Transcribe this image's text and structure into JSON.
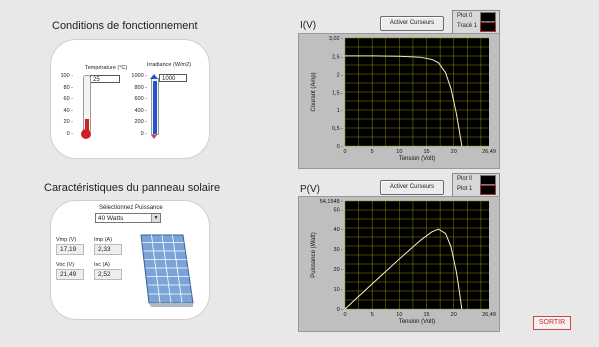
{
  "conditions": {
    "title": "Conditions de fonctionnement",
    "temperature": {
      "label": "Température (°C)",
      "value": "25",
      "ticks": [
        "100",
        "80",
        "60",
        "40",
        "20",
        "0"
      ],
      "fill_fraction": 0.25
    },
    "irradiance": {
      "label": "Irradiance (W/m2)",
      "value": "1000",
      "ticks": [
        "1000",
        "800",
        "600",
        "400",
        "200",
        "0"
      ],
      "fill_fraction": 1.0
    }
  },
  "panel": {
    "title": "Caractéristiques du panneau solaire",
    "select_label": "Sélectionnez Puissance",
    "select_value": "40 Watts",
    "vmp_label": "Vmp (V)",
    "vmp_value": "17,19",
    "imp_label": "Imp (A)",
    "imp_value": "2,33",
    "voc_label": "Voc (V)",
    "voc_value": "21,49",
    "isc_label": "Isc (A)",
    "isc_value": "2,52"
  },
  "iv_graph": {
    "title": "I(V)",
    "cursor_button": "Activer Curseurs",
    "legend": [
      "Plot 0",
      "Tracé 1"
    ]
  },
  "pv_graph": {
    "title": "P(V)",
    "cursor_button": "Activer Curseurs",
    "legend": [
      "Plot 0",
      "Plot 1"
    ]
  },
  "exit_button": "SORTIR",
  "colors": {
    "plot_background": "#000000",
    "grid": "#8a8a00",
    "curve": "#f5f0c8",
    "thermometer": "#cc2222",
    "irradiance_bar": "#2255cc",
    "exit_text": "#dd2222"
  },
  "chart_data": [
    {
      "type": "line",
      "title": "I(V)",
      "xlabel": "Tension (Volt)",
      "ylabel": "Courant (Amp)",
      "xlim": [
        0,
        26.49
      ],
      "ylim": [
        0,
        3.02
      ],
      "x_ticks": [
        "0",
        "5",
        "10",
        "15",
        "20",
        "26,49"
      ],
      "y_ticks": [
        "0",
        "0,5",
        "1",
        "1,5",
        "2",
        "2,5",
        "3,02"
      ],
      "grid": true,
      "series": [
        {
          "x": [
            0,
            5,
            10,
            14,
            16,
            17.19,
            18.5,
            19.5,
            20.5,
            21.0,
            21.49
          ],
          "values": [
            2.52,
            2.52,
            2.51,
            2.48,
            2.42,
            2.33,
            2.05,
            1.6,
            0.9,
            0.45,
            0
          ]
        }
      ]
    },
    {
      "type": "line",
      "title": "P(V)",
      "xlabel": "Tension (Volt)",
      "ylabel": "Puissance (Watt)",
      "xlim": [
        0,
        26.49
      ],
      "ylim": [
        0,
        54.1548
      ],
      "x_ticks": [
        "0",
        "5",
        "10",
        "15",
        "20",
        "26,49"
      ],
      "y_ticks": [
        "0",
        "10",
        "20",
        "30",
        "40",
        "50",
        "54,1548"
      ],
      "grid": true,
      "series": [
        {
          "x": [
            0,
            5,
            10,
            14,
            16,
            17.19,
            18.5,
            19.5,
            20.5,
            21.0,
            21.49
          ],
          "values": [
            0,
            12.6,
            25.1,
            34.7,
            38.7,
            40.05,
            37.9,
            31.2,
            18.4,
            9.5,
            0
          ]
        }
      ]
    }
  ]
}
